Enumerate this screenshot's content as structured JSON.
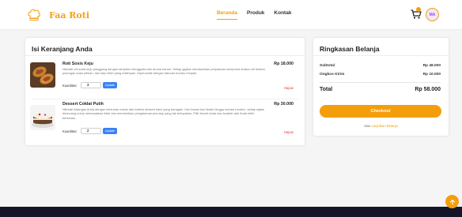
{
  "brand": {
    "name": "Faa Roti",
    "logo_icon": "chef-hat-icon"
  },
  "nav": {
    "items": [
      {
        "label": "Beranda",
        "active": true
      },
      {
        "label": "Produk",
        "active": false
      },
      {
        "label": "Kontak",
        "active": false
      }
    ]
  },
  "header": {
    "cart_icon": "cart-icon",
    "avatar_text": "MA"
  },
  "cart": {
    "title": "Isi Keranjang Anda",
    "qty_label": "Kuantitas:",
    "update_label": "Update",
    "remove_label": "Hapus",
    "items": [
      {
        "name": "Roti Sosis Keju",
        "price": "Rp 18.000",
        "description": "Nikmati roti sosis keju panggang dengan tampilan menggoda dan aroma harum. Setiap gigitan menawarkan perpaduan sempurna antara roti lembut, potongan sosis pilihan, dan keju leleh yang melimpah. Dipercantik dengan taburan bumbu rempah.",
        "quantity": "3",
        "image": "sausage-cheese-bread"
      },
      {
        "name": "Dessert Coklat Putih",
        "price": "Rp 30.000",
        "description": "Nikmati hidangan Anda dengan sentuhan manis dari koleksi dessert kami yang beragam. Dari kreasi kue klasik hingga inovasi modern, setiap sajian dirancang untuk memanjakan lidah dan memberikan pengalaman penutup yang tak terlupakan. Pilih favorit Anda dan buatlah dari Anda lebih berkesan.",
        "quantity": "2",
        "image": "white-chocolate-cake"
      }
    ]
  },
  "summary": {
    "title": "Ringkasan Belanja",
    "subtotal_label": "Subtotal",
    "subtotal_value": "Rp 48.000",
    "shipping_label": "Ongkos Kirim",
    "shipping_value": "Rp 10.000",
    "total_label": "Total",
    "total_value": "Rp 58.000",
    "checkout_label": "Checkout",
    "continue_prefix": "atau",
    "continue_link": "Lanjutkan Belanja"
  },
  "colors": {
    "accent": "#f59e0b",
    "blue": "#3b82f6",
    "danger": "#e53935",
    "footer": "#15152a"
  }
}
